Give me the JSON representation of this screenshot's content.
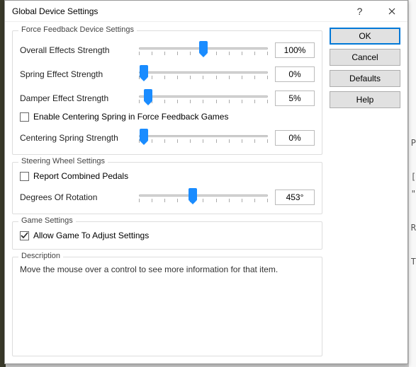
{
  "window": {
    "title": "Global Device Settings"
  },
  "groups": {
    "ffb": {
      "legend": "Force Feedback Device Settings",
      "overall": {
        "label": "Overall Effects Strength",
        "value": "100%",
        "pos": 50
      },
      "spring": {
        "label": "Spring Effect Strength",
        "value": "0%",
        "pos": 4
      },
      "damper": {
        "label": "Damper Effect Strength",
        "value": "5%",
        "pos": 7
      },
      "enable_centering": {
        "label": "Enable Centering Spring in Force Feedback Games",
        "checked": false
      },
      "centering": {
        "label": "Centering Spring Strength",
        "value": "0%",
        "pos": 4
      }
    },
    "wheel": {
      "legend": "Steering Wheel Settings",
      "combined": {
        "label": "Report Combined Pedals",
        "checked": false
      },
      "rotation": {
        "label": "Degrees Of Rotation",
        "value": "453°",
        "pos": 42
      }
    },
    "game": {
      "legend": "Game Settings",
      "allow": {
        "label": "Allow Game To Adjust Settings",
        "checked": true
      }
    },
    "desc": {
      "legend": "Description",
      "text": "Move the mouse over a control to see more information for that item."
    }
  },
  "buttons": {
    "ok": "OK",
    "cancel": "Cancel",
    "defaults": "Defaults",
    "help": "Help"
  }
}
